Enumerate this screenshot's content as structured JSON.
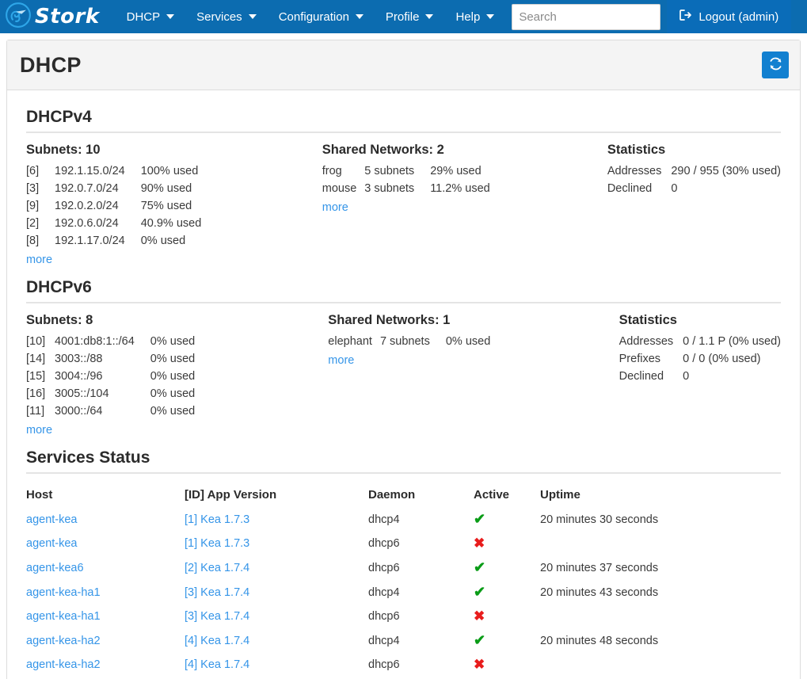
{
  "navbar": {
    "brand": "Stork",
    "brand_icon": "stork-logo-icon",
    "menu": [
      {
        "label": "DHCP",
        "icon": "chevron-down-icon"
      },
      {
        "label": "Services",
        "icon": "chevron-down-icon"
      },
      {
        "label": "Configuration",
        "icon": "chevron-down-icon"
      },
      {
        "label": "Profile",
        "icon": "chevron-down-icon"
      },
      {
        "label": "Help",
        "icon": "chevron-down-icon"
      }
    ],
    "search": {
      "value": "",
      "placeholder": "Search"
    },
    "logout": {
      "label": "Logout (admin)",
      "icon": "sign-out-icon"
    },
    "bg_color": "#0c6cb0"
  },
  "page": {
    "title": "DHCP",
    "refresh": {
      "icon": "refresh-icon",
      "label": ""
    }
  },
  "dhcpv4": {
    "section_title": "DHCPv4",
    "subnets": {
      "heading": "Subnets: 10",
      "rows": [
        {
          "id": "[6]",
          "subnet": "192.1.15.0/24",
          "used": "100% used"
        },
        {
          "id": "[3]",
          "subnet": "192.0.7.0/24",
          "used": "90% used"
        },
        {
          "id": "[9]",
          "subnet": "192.0.2.0/24",
          "used": "75% used"
        },
        {
          "id": "[2]",
          "subnet": "192.0.6.0/24",
          "used": "40.9% used"
        },
        {
          "id": "[8]",
          "subnet": "192.1.17.0/24",
          "used": "0% used"
        }
      ],
      "more": "more"
    },
    "shared_networks": {
      "heading": "Shared Networks: 2",
      "rows": [
        {
          "name": "frog",
          "subnets": "5 subnets",
          "used": "29% used"
        },
        {
          "name": "mouse",
          "subnets": "3 subnets",
          "used": "11.2% used"
        }
      ],
      "more": "more"
    },
    "statistics": {
      "heading": "Statistics",
      "rows": [
        {
          "label": "Addresses",
          "value": "290 / 955 (30% used)"
        },
        {
          "label": "Declined",
          "value": "0"
        }
      ]
    }
  },
  "dhcpv6": {
    "section_title": "DHCPv6",
    "subnets": {
      "heading": "Subnets: 8",
      "rows": [
        {
          "id": "[10]",
          "subnet": "4001:db8:1::/64",
          "used": "0% used"
        },
        {
          "id": "[14]",
          "subnet": "3003::/88",
          "used": "0% used"
        },
        {
          "id": "[15]",
          "subnet": "3004::/96",
          "used": "0% used"
        },
        {
          "id": "[16]",
          "subnet": "3005::/104",
          "used": "0% used"
        },
        {
          "id": "[11]",
          "subnet": "3000::/64",
          "used": "0% used"
        }
      ],
      "more": "more"
    },
    "shared_networks": {
      "heading": "Shared Networks: 1",
      "rows": [
        {
          "name": "elephant",
          "subnets": "7 subnets",
          "used": "0% used"
        }
      ],
      "more": "more"
    },
    "statistics": {
      "heading": "Statistics",
      "rows": [
        {
          "label": "Addresses",
          "value": "0 / 1.1 P (0% used)"
        },
        {
          "label": "Prefixes",
          "value": "0 / 0 (0% used)"
        },
        {
          "label": "Declined",
          "value": "0"
        }
      ]
    }
  },
  "services_status": {
    "section_title": "Services Status",
    "columns": [
      "Host",
      "[ID] App Version",
      "Daemon",
      "Active",
      "Uptime"
    ],
    "rows": [
      {
        "host": "agent-kea",
        "app": "[1] Kea 1.7.3",
        "daemon": "dhcp4",
        "active": "yes",
        "active_icon": "check-icon",
        "uptime": "20 minutes 30 seconds"
      },
      {
        "host": "agent-kea",
        "app": "[1] Kea 1.7.3",
        "daemon": "dhcp6",
        "active": "no",
        "active_icon": "cross-icon",
        "uptime": ""
      },
      {
        "host": "agent-kea6",
        "app": "[2] Kea 1.7.4",
        "daemon": "dhcp6",
        "active": "yes",
        "active_icon": "check-icon",
        "uptime": "20 minutes 37 seconds"
      },
      {
        "host": "agent-kea-ha1",
        "app": "[3] Kea 1.7.4",
        "daemon": "dhcp4",
        "active": "yes",
        "active_icon": "check-icon",
        "uptime": "20 minutes 43 seconds"
      },
      {
        "host": "agent-kea-ha1",
        "app": "[3] Kea 1.7.4",
        "daemon": "dhcp6",
        "active": "no",
        "active_icon": "cross-icon",
        "uptime": ""
      },
      {
        "host": "agent-kea-ha2",
        "app": "[4] Kea 1.7.4",
        "daemon": "dhcp4",
        "active": "yes",
        "active_icon": "check-icon",
        "uptime": "20 minutes 48 seconds"
      },
      {
        "host": "agent-kea-ha2",
        "app": "[4] Kea 1.7.4",
        "daemon": "dhcp6",
        "active": "no",
        "active_icon": "cross-icon",
        "uptime": ""
      }
    ]
  },
  "colors": {
    "navbar": "#0c6cb0",
    "link": "#3595e8",
    "active_yes": "#0a9c17",
    "active_no": "#e81c1c",
    "accent_button": "#1280d0"
  },
  "glyphs": {
    "check": "✔",
    "cross": "✖"
  }
}
